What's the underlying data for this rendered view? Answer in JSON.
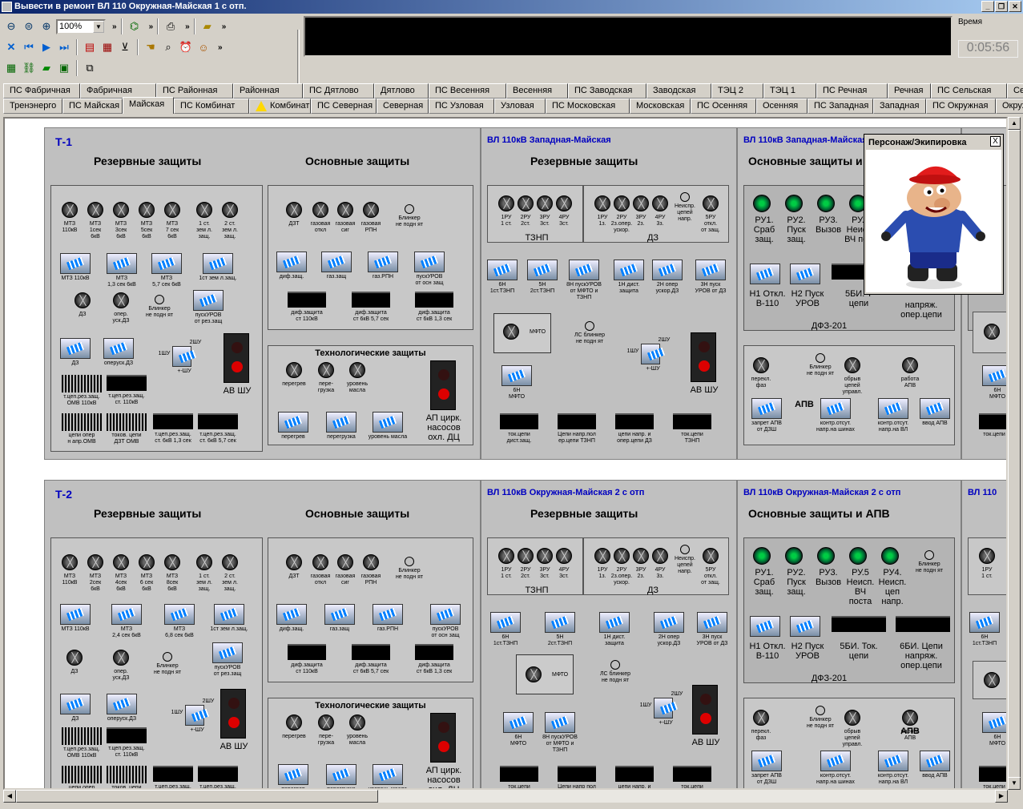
{
  "window": {
    "title": "Вывести в ремонт ВЛ 110 Окружная-Майская 1 с отп."
  },
  "toolbar": {
    "zoom": "100%"
  },
  "time": {
    "label": "Время",
    "value": "0:05:56"
  },
  "tabs_row1": [
    "ПС Фабричная",
    "Фабричная",
    "ПС Районная",
    "Районная",
    "ПС Дятлово",
    "Дятлово",
    "ПС Весенняя",
    "Весенняя",
    "ПС Заводская",
    "Заводская",
    "ТЭЦ 2",
    "ТЭЦ 1",
    "ПС Речная",
    "Речная",
    "ПС Сельская",
    "Сельская"
  ],
  "tabs_row2": [
    "Тренэнерго",
    "ПС Майская",
    "Майская",
    "ПС Комбинат",
    "Комбинат",
    "ПС Северная",
    "Северная",
    "ПС Узловая",
    "Узловая",
    "ПС Московская",
    "Московская",
    "ПС Осенняя",
    "Осенняя",
    "ПС Западная",
    "Западная",
    "ПС Окружная",
    "Окружная"
  ],
  "popup": {
    "title": "Персонаж/Экипировка",
    "close": "X"
  },
  "t1": {
    "name": "Т-1",
    "reserve": "Резервные защиты",
    "main": "Основные защиты",
    "tech": "Технологические защиты",
    "knobs_r": [
      "МТЗ\n110кВ",
      "МТЗ\n1сек\n6кВ",
      "МТЗ\n3сек\n6кВ",
      "МТЗ\n5сек\n6кВ",
      "МТЗ\n7 сек\n6кВ",
      "1 ст.\nзем л.\nзащ.",
      "2 ст.\nзем л.\nзащ."
    ],
    "sw_r": [
      "МТЗ 110кВ",
      "МТЗ\n1,3 сек 6кВ",
      "МТЗ\n5,7 сек 6кВ",
      "1ст зем л.защ."
    ],
    "row3": [
      "ДЗ",
      "опер.\nуск.ДЗ",
      "Блинкер\nне подн ят",
      "пускУРОВ\nот рез.защ"
    ],
    "sw_r2": [
      "ДЗ",
      "оперуск.ДЗ"
    ],
    "stacks": [
      "т.цеп.рез.защ.\nОМВ 110кВ",
      "т.цеп.рез.защ.\nст. 110кВ"
    ],
    "bottom": [
      "цепи опер\nн апр.ОМВ",
      "токов. цепи\nДЗТ ОМВ",
      "т.цеп.рез.защ.\nст. 6кВ 1,3 сек",
      "т.цеп.рез.защ.\nст. 6кВ 5,7 сек"
    ],
    "knobs_m": [
      "ДЗТ",
      "газовая\nоткл",
      "газовая\nсиг",
      "газовая\nРПН",
      "Блинкер\nне подн ят"
    ],
    "sw_m": [
      "диф.защ.",
      "газ.защ",
      "газ.РПН",
      "пускУРОВ\nот осн защ"
    ],
    "bk_m": [
      "диф.защита\nст 110кВ",
      "диф.защита\nст 6кВ 5,7 сек",
      "диф.защита\nст 6кВ 1,3 сек"
    ],
    "tech_k": [
      "перегрев",
      "пере-\nгрузка",
      "уровень\nмасла"
    ],
    "tech_s": [
      "перегрев",
      "перегрузка",
      "уровень масла"
    ],
    "ap": "АП цирк.\nнасосов\nохл. ДЦ",
    "av": "АВ ШУ",
    "sh1": "1ШУ",
    "sh2": "2ШУ",
    "sh3": "+-ШУ"
  },
  "w1": {
    "title": "ВЛ 110кВ Западная-Майская",
    "reserve": "Резервные защиты",
    "tznp": [
      "1РУ\n1 ст.",
      "2РУ\n2ст.",
      "3РУ\n3ст.",
      "4РУ\n3ст."
    ],
    "dz": [
      "1РУ\n1з.",
      "2РУ\n2з.опер.\nускор.",
      "3РУ\n2з.",
      "4РУ\n3з.",
      "Неиспр.\nцепей\nнапр.",
      "5РУ\nоткл.\nот защ."
    ],
    "tznp_lbl": "ТЗНП",
    "dz_lbl": "ДЗ",
    "sw": [
      "6Н\n1ст.ТЗНП",
      "5Н\n2ст.ТЗНП",
      "8Н пускУРОВ\nот МФТО и\nТЗНП",
      "1Н дист.\nзащита",
      "2Н опер\nускор.ДЗ",
      "3Н пуск\nУРОВ от ДЗ"
    ],
    "mfto": "МФТО",
    "ls": "ЛС блинкер\nне подн ят",
    "sw6": "6Н\nМФТО",
    "bk": [
      "ток.цепи\nдист.защ.",
      "Цепи напр.пол\nер.цепи ТЗНП",
      "цепи напр. и\nопер.цепи ДЗ",
      "ток.цепи\nТЗНП"
    ]
  },
  "w2": {
    "title": "ВЛ 110кВ Западная-Майская",
    "main": "Основные защиты и АПВ",
    "gk": [
      "РУ1.\nСраб\nзащ.",
      "РУ2.\nПуск\nзащ.",
      "РУ3.\nВызов",
      "РУ.5\nНеисп.\nВЧ пост"
    ],
    "sw": [
      "Н1 Откл.\nВ-110",
      "Н2 Пуск\nУРОВ",
      "5БИ. Т\nцепи",
      "напряж.\nопер.цепи"
    ],
    "dfz": "ДФЗ-201",
    "apv_k": [
      "перекл.\nфаз",
      "Блинкер\nне подн ят",
      "обрыв\nцепей\nуправл.",
      "работа\nАПВ"
    ],
    "apv": "АПВ",
    "apv_s": [
      "запрет АПВ\nот ДЗШ",
      "контр.отсут.\nнапр.на шинах",
      "контр.отсут.\nнапр.на ВЛ",
      "ввод АПВ"
    ]
  },
  "t2": {
    "name": "Т-2",
    "reserve": "Резервные защиты",
    "main": "Основные защиты",
    "tech": "Технологические защиты",
    "knobs_r": [
      "МТЗ\n110кВ",
      "МТЗ\n2сек\n6кВ",
      "МТЗ\n4сек\n6кВ",
      "МТЗ\n6 сек\n6кВ",
      "МТЗ\n8сек\n6кВ",
      "1 ст.\nзем л.\nзащ.",
      "2 ст.\nзем л.\nзащ."
    ],
    "sw_r": [
      "МТЗ 110кВ",
      "МТЗ\n2,4 сек 6кВ",
      "МТЗ\n6,8 сек 6кВ",
      "1ст зем л.защ."
    ],
    "row3": [
      "ДЗ",
      "опер.\nуск.ДЗ",
      "Блинкер\nне подн ят",
      "пускУРОВ\nот рез.защ"
    ],
    "stacks": [
      "т.цеп.рез.защ.\nОМВ 110кВ",
      "т.цеп.рез.защ.\nст. 110кВ"
    ],
    "bottom": [
      "цепи опер",
      "токов. цепи",
      "т.цеп.рез.защ.",
      "т.цеп.рез.защ."
    ],
    "bk_m": [
      "диф.защита\nст 110кВ",
      "диф.защита\nст 6кВ 5,7 сек",
      "диф.защита\nст 6кВ 1,3 сек"
    ],
    "av": "АВ ШУ",
    "ap": "АП цирк.\nнасосов\nохл. ДЦ"
  },
  "w3": {
    "title": "ВЛ 110кВ Окружная-Майская 2 с отп",
    "reserve": "Резервные защиты",
    "mfto": "МФТО",
    "sw": [
      "6Н\n1ст.ТЗНП",
      "5Н\n2ст.ТЗНП",
      "1Н дист.\nзащита",
      "2Н опер\nускор.ДЗ",
      "3Н пуск\nУРОВ от ДЗ"
    ],
    "sw2": [
      "6Н\nМФТО",
      "8Н пускУРОВ\nот МФТО и\nТЗНП"
    ],
    "bk": [
      "ток.цепи",
      "Цепи напр пол",
      "цепи напр. и",
      "ток.цепи"
    ]
  },
  "w4": {
    "title": "ВЛ 110кВ Окружная-Майская 2 с отп",
    "main": "Основные защиты и АПВ",
    "gk": [
      "РУ1.\nСраб\nзащ.",
      "РУ2.\nПуск\nзащ.",
      "РУ3.\nВызов",
      "РУ.5\nНеисп.\nВЧ поста",
      "РУ4.\nНеисп.\nцеп напр."
    ],
    "sw": [
      "Н1 Откл.\nВ-110",
      "Н2 Пуск\nУРОВ",
      "5БИ. Ток.\nцепи",
      "6БИ. Цепи\nнапряж.\nопер.цепи"
    ],
    "dfz": "ДФЗ-201",
    "apv": "АПВ",
    "apv_k": [
      "перекл.\nфаз",
      "Блинкер\nне подн ят",
      "обрыв\nцепей\nуправл.",
      "работа\nАПВ"
    ],
    "apv_s": [
      "запрет АПВ\nот ДЗШ",
      "контр.отсут.\nнапр.на шинах",
      "контр.отсут.\nнапр.на ВЛ",
      "ввод АПВ"
    ]
  },
  "w5": {
    "title": "ВЛ 110",
    "tznp": [
      "1РУ\n1 ст.",
      "2РУ\n2ст."
    ],
    "sw": "6Н\n1ст.ТЗНП",
    "sw2": "6Н\nМФТО",
    "bk": "ток.цепи"
  }
}
